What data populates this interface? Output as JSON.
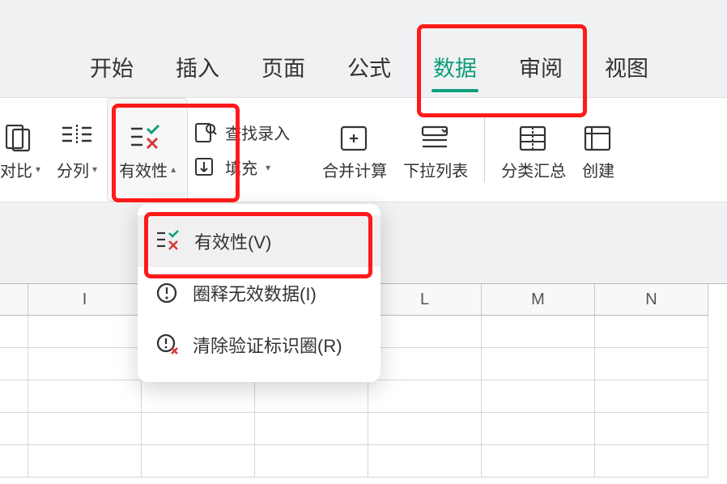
{
  "tabs": {
    "start": "开始",
    "insert": "插入",
    "page": "页面",
    "formula": "公式",
    "data": "数据",
    "review": "审阅",
    "view": "视图",
    "active": "data"
  },
  "ribbon": {
    "compare": "对比",
    "split": "分列",
    "validity": "有效性",
    "find_entry": "查找录入",
    "fill": "填充",
    "merge_calc": "合并计算",
    "dropdown_list": "下拉列表",
    "subtotal": "分类汇总",
    "create": "创建"
  },
  "menu": {
    "validity_v": "有效性(V)",
    "circle_invalid": "圈释无效数据(I)",
    "clear_circles": "清除验证标识圈(R)"
  },
  "columns": {
    "c0": "",
    "c1": "I",
    "c2": "",
    "c3": "",
    "c4": "L",
    "c5": "M",
    "c6": "N"
  }
}
